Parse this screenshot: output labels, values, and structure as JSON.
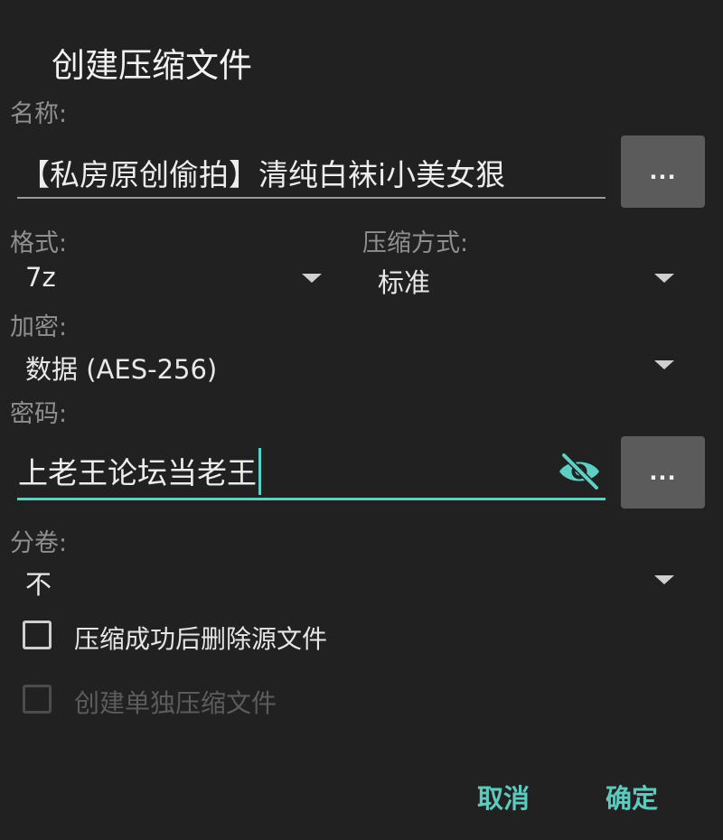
{
  "dialog": {
    "title": "创建压缩文件"
  },
  "name_section": {
    "label": "名称:",
    "value": "【私房原创偷拍】清纯白袜i小美女狠",
    "browse_label": "..."
  },
  "format_section": {
    "label": "格式:",
    "value": "7z"
  },
  "compression_method_section": {
    "label": "压缩方式:",
    "value": "标准"
  },
  "encryption_section": {
    "label": "加密:",
    "value": "数据 (AES-256)"
  },
  "password_section": {
    "label": "密码:",
    "value": "上老王论坛当老王",
    "browse_label": "...",
    "visibility_icon": "eye-off-icon"
  },
  "split_section": {
    "label": "分卷:",
    "value": "不"
  },
  "options": [
    {
      "label": "压缩成功后删除源文件",
      "checked": false,
      "enabled": true
    },
    {
      "label": "创建单独压缩文件",
      "checked": false,
      "enabled": false
    }
  ],
  "actions": {
    "cancel_label": "取消",
    "confirm_label": "确定"
  },
  "colors": {
    "background": "#212121",
    "accent": "#5ed0c3",
    "button_bg": "#5b5b5b"
  }
}
